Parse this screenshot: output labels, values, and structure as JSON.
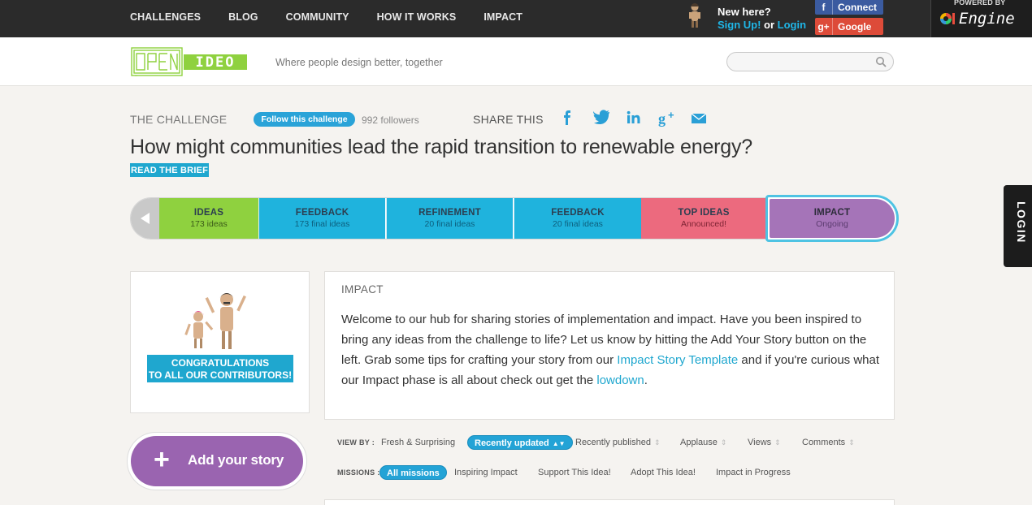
{
  "topnav": [
    "CHALLENGES",
    "BLOG",
    "COMMUNITY",
    "HOW IT WORKS",
    "IMPACT"
  ],
  "auth": {
    "new_here": "New here?",
    "signup": "Sign Up!",
    "or": " or ",
    "login": "Login",
    "facebook": "Connect",
    "google": "Google"
  },
  "powered": {
    "label": "POWERED BY",
    "brand": "Engine"
  },
  "header": {
    "logo_open": "OPEN",
    "logo_ideo": "IDEO",
    "tagline": "Where people design better, together",
    "search_placeholder": ""
  },
  "challenge": {
    "label": "THE CHALLENGE",
    "follow": "Follow this challenge",
    "followers": "992 followers",
    "share_label": "SHARE THIS",
    "share_icons": [
      "facebook-icon",
      "twitter-icon",
      "linkedin-icon",
      "googleplus-icon",
      "email-icon"
    ],
    "title": "How might communities lead the rapid transition to renewable energy?",
    "read_brief": "READ THE BRIEF"
  },
  "phases": [
    {
      "name": "IDEAS",
      "sub": "173 ideas"
    },
    {
      "name": "FEEDBACK",
      "sub": "173 final ideas"
    },
    {
      "name": "REFINEMENT",
      "sub": "20 final ideas"
    },
    {
      "name": "FEEDBACK",
      "sub": "20 final ideas"
    },
    {
      "name": "TOP IDEAS",
      "sub": "Announced!"
    },
    {
      "name": "IMPACT",
      "sub": "Ongoing"
    }
  ],
  "login_tab": "LOGIN",
  "congrats": {
    "line1": "CONGRATULATIONS",
    "line2": "TO ALL OUR CONTRIBUTORS!"
  },
  "impact": {
    "heading": "IMPACT",
    "text1": "Welcome to our hub for sharing stories of implementation and impact. Have you been inspired to bring any ideas from the challenge to life? Let us know by hitting the Add Your Story button on the left. Grab some tips for crafting your story from our ",
    "link1": "Impact Story Template",
    "text2": " and if you're curious what our Impact phase is all about check out get the ",
    "link2": "lowdown",
    "text3": "."
  },
  "add_story": {
    "plus": "+",
    "label": "Add your story"
  },
  "view_by": {
    "label": "VIEW BY :",
    "options": [
      "Fresh & Surprising",
      "Recently updated",
      "Recently published",
      "Applause",
      "Views",
      "Comments"
    ],
    "selected": "Recently updated"
  },
  "missions": {
    "label": "MISSIONS :",
    "options": [
      "All missions",
      "Inspiring Impact",
      "Support This Idea!",
      "Adopt This Idea!",
      "Impact in Progress"
    ],
    "selected": "All missions"
  },
  "colors": {
    "accent_blue": "#1fa7cf",
    "ideas_green": "#8fd13f",
    "feedback_blue": "#1fb3dd",
    "topideas_pink": "#ec6a7e",
    "impact_purple": "#a574b8"
  }
}
